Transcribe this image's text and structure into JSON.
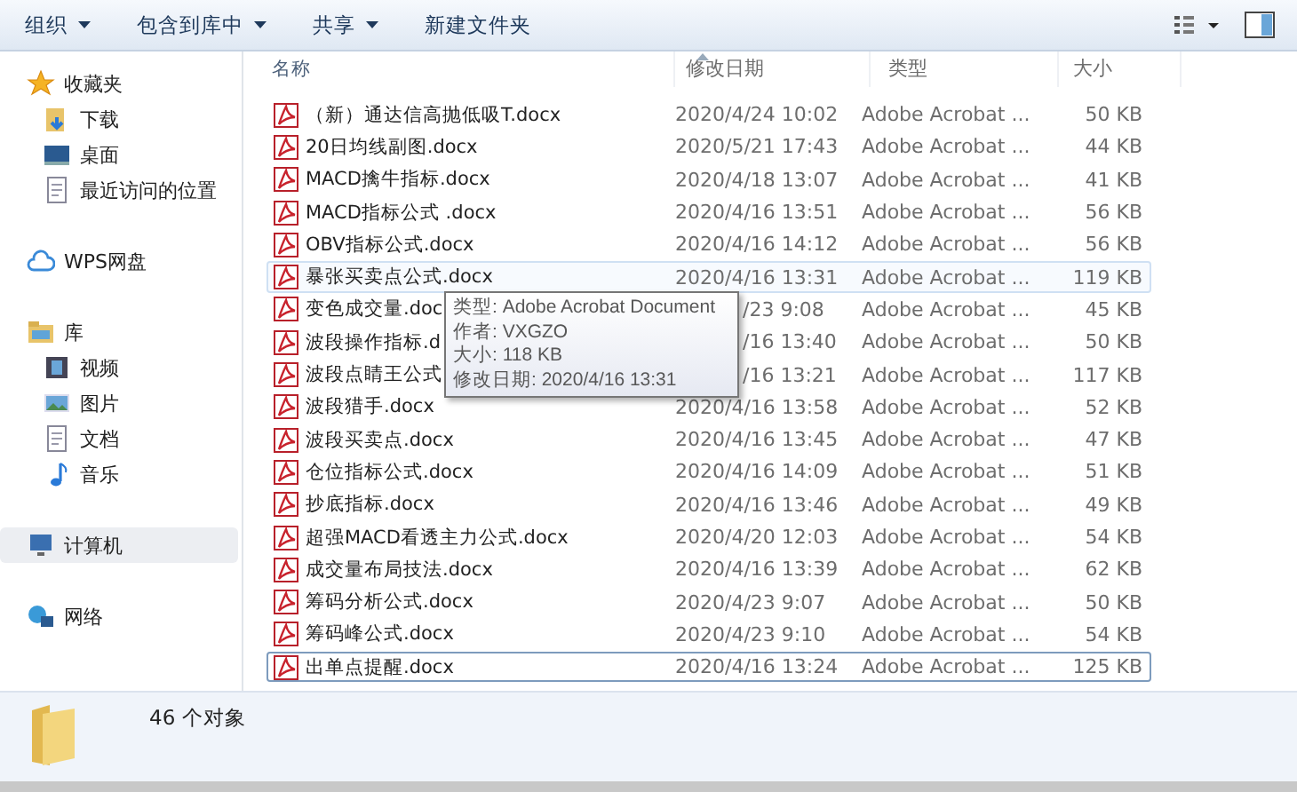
{
  "toolbar": {
    "buttons": [
      {
        "label": "组织",
        "dropdown": true
      },
      {
        "label": "包含到库中",
        "dropdown": true
      },
      {
        "label": "共享",
        "dropdown": true
      },
      {
        "label": "新建文件夹",
        "dropdown": false
      }
    ]
  },
  "sidebar": {
    "groups": [
      {
        "label": "收藏夹",
        "kind": "favorites",
        "selected": false,
        "children": [
          {
            "label": "下载",
            "kind": "download",
            "selected": false
          },
          {
            "label": "桌面",
            "kind": "desktop",
            "selected": false
          },
          {
            "label": "最近访问的位置",
            "kind": "recent",
            "selected": false
          }
        ]
      },
      {
        "label": "WPS网盘",
        "kind": "cloud",
        "selected": false
      },
      {
        "label": "库",
        "kind": "library",
        "selected": false,
        "children": [
          {
            "label": "视频",
            "kind": "video",
            "selected": false
          },
          {
            "label": "图片",
            "kind": "pictures",
            "selected": false
          },
          {
            "label": "文档",
            "kind": "documents",
            "selected": false
          },
          {
            "label": "音乐",
            "kind": "music",
            "selected": false
          }
        ]
      },
      {
        "label": "计算机",
        "kind": "computer",
        "selected": true
      },
      {
        "label": "网络",
        "kind": "network",
        "selected": false
      }
    ]
  },
  "table": {
    "columns": [
      "名称",
      "修改日期",
      "类型",
      "大小"
    ],
    "rows": [
      {
        "name": "（新）通达信高抛低吸T.docx",
        "date": "2020/4/24 10:02",
        "type": "Adobe Acrobat ...",
        "size": "50 KB",
        "hover": false,
        "focus": false,
        "covered": false
      },
      {
        "name": "20日均线副图.docx",
        "date": "2020/5/21 17:43",
        "type": "Adobe Acrobat ...",
        "size": "44 KB",
        "hover": false,
        "focus": false,
        "covered": false
      },
      {
        "name": "MACD擒牛指标.docx",
        "date": "2020/4/18 13:07",
        "type": "Adobe Acrobat ...",
        "size": "41 KB",
        "hover": false,
        "focus": false,
        "covered": false
      },
      {
        "name": "MACD指标公式 .docx",
        "date": "2020/4/16 13:51",
        "type": "Adobe Acrobat ...",
        "size": "56 KB",
        "hover": false,
        "focus": false,
        "covered": false
      },
      {
        "name": "OBV指标公式.docx",
        "date": "2020/4/16 14:12",
        "type": "Adobe Acrobat ...",
        "size": "56 KB",
        "hover": false,
        "focus": false,
        "covered": false
      },
      {
        "name": "暴张买卖点公式.docx",
        "date": "2020/4/16 13:31",
        "type": "Adobe Acrobat ...",
        "size": "119 KB",
        "hover": true,
        "focus": false,
        "covered": false
      },
      {
        "name": "变色成交量.doc",
        "date": "/23 9:08",
        "type": "Adobe Acrobat ...",
        "size": "45 KB",
        "hover": false,
        "focus": false,
        "covered": true
      },
      {
        "name": "波段操作指标.d",
        "date": "/16 13:40",
        "type": "Adobe Acrobat ...",
        "size": "50 KB",
        "hover": false,
        "focus": false,
        "covered": true
      },
      {
        "name": "波段点睛王公式",
        "date": "/16 13:21",
        "type": "Adobe Acrobat ...",
        "size": "117 KB",
        "hover": false,
        "focus": false,
        "covered": true
      },
      {
        "name": "波段猎手.docx",
        "date": "2020/4/16 13:58",
        "type": "Adobe Acrobat ...",
        "size": "52 KB",
        "hover": false,
        "focus": false,
        "covered": false
      },
      {
        "name": "波段买卖点.docx",
        "date": "2020/4/16 13:45",
        "type": "Adobe Acrobat ...",
        "size": "47 KB",
        "hover": false,
        "focus": false,
        "covered": false
      },
      {
        "name": "仓位指标公式.docx",
        "date": "2020/4/16 14:09",
        "type": "Adobe Acrobat ...",
        "size": "51 KB",
        "hover": false,
        "focus": false,
        "covered": false
      },
      {
        "name": "抄底指标.docx",
        "date": "2020/4/16 13:46",
        "type": "Adobe Acrobat ...",
        "size": "49 KB",
        "hover": false,
        "focus": false,
        "covered": false
      },
      {
        "name": "超强MACD看透主力公式.docx",
        "date": "2020/4/20 12:03",
        "type": "Adobe Acrobat ...",
        "size": "54 KB",
        "hover": false,
        "focus": false,
        "covered": false
      },
      {
        "name": "成交量布局技法.docx",
        "date": "2020/4/16 13:39",
        "type": "Adobe Acrobat ...",
        "size": "62 KB",
        "hover": false,
        "focus": false,
        "covered": false
      },
      {
        "name": "筹码分析公式.docx",
        "date": "2020/4/23 9:07",
        "type": "Adobe Acrobat ...",
        "size": "50 KB",
        "hover": false,
        "focus": false,
        "covered": false
      },
      {
        "name": "筹码峰公式.docx",
        "date": "2020/4/23 9:10",
        "type": "Adobe Acrobat ...",
        "size": "54 KB",
        "hover": false,
        "focus": false,
        "covered": false
      },
      {
        "name": "出单点提醒.docx",
        "date": "2020/4/16 13:24",
        "type": "Adobe Acrobat ...",
        "size": "125 KB",
        "hover": false,
        "focus": true,
        "covered": false
      }
    ]
  },
  "tooltip": {
    "lines": [
      "类型: Adobe Acrobat Document",
      "作者: VXGZO",
      "大小: 118 KB",
      "修改日期: 2020/4/16 13:31"
    ]
  },
  "status_bar": {
    "text": "46 个对象"
  }
}
